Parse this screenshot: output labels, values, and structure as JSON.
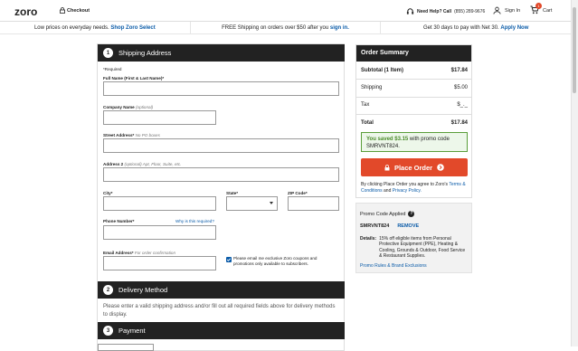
{
  "header": {
    "logo_text": "zoro",
    "checkout_label": "Checkout",
    "help_label": "Need Help? Call",
    "help_phone": "(855) 289-9676",
    "signin_label": "Sign In",
    "cart_label": "Cart",
    "cart_count": "1"
  },
  "promobar": {
    "left_text": "Low prices on everyday needs.",
    "left_link": "Shop Zoro Select",
    "mid_text": "FREE Shipping on orders over $50 after you",
    "mid_link": "sign in.",
    "right_text": "Get 30 days to pay with Net 30.",
    "right_link": "Apply Now"
  },
  "shipping": {
    "step": "1",
    "title": "Shipping Address",
    "required_note": "*Required",
    "full_name_label": "Full Name (First & Last Name)*",
    "company_label": "Company Name",
    "company_hint": "(optional)",
    "street_label": "Street Address*",
    "street_hint": "No PO boxes",
    "address2_label": "Address 2",
    "address2_hint": "(optional) Apt, Floor, Suite, etc.",
    "city_label": "City*",
    "state_label": "State*",
    "zip_label": "ZIP Code*",
    "phone_label": "Phone Number*",
    "why_link": "Why is this required?",
    "email_label": "Email Address*",
    "email_hint": "For order confirmation",
    "optin_text": "Please email me exclusive Zoro coupons and promotions only available to subscribers."
  },
  "delivery": {
    "step": "2",
    "title": "Delivery Method",
    "message": "Please enter a valid shipping address and/or fill out all required fields above for delivery methods to display."
  },
  "payment": {
    "step": "3",
    "title": "Payment"
  },
  "summary": {
    "title": "Order Summary",
    "subtotal_label": "Subtotal (1 Item)",
    "subtotal_value": "$17.84",
    "shipping_label": "Shipping",
    "shipping_value": "$5.00",
    "tax_label": "Tax",
    "tax_value": "$_._",
    "total_label": "Total",
    "total_value": "$17.84",
    "saved_prefix": "You saved $3.15",
    "saved_suffix": "with promo code SMRVNT824.",
    "place_order": "Place Order",
    "terms_pre": "By clicking Place Order you agree to Zoro's",
    "terms_link": "Terms & Conditions",
    "terms_and": "and",
    "privacy_link": "Privacy Policy."
  },
  "promo": {
    "title": "Promo Code Applied",
    "code": "SMRVNT824",
    "remove": "REMOVE",
    "details_label": "Details:",
    "details_text": "15% off eligible items from Personal Protective Equipment (PPE), Heating & Cooling, Grounds & Outdoor, Food Service & Restaurant Supplies.",
    "rules_link": "Promo Rules & Brand Exclusions"
  }
}
